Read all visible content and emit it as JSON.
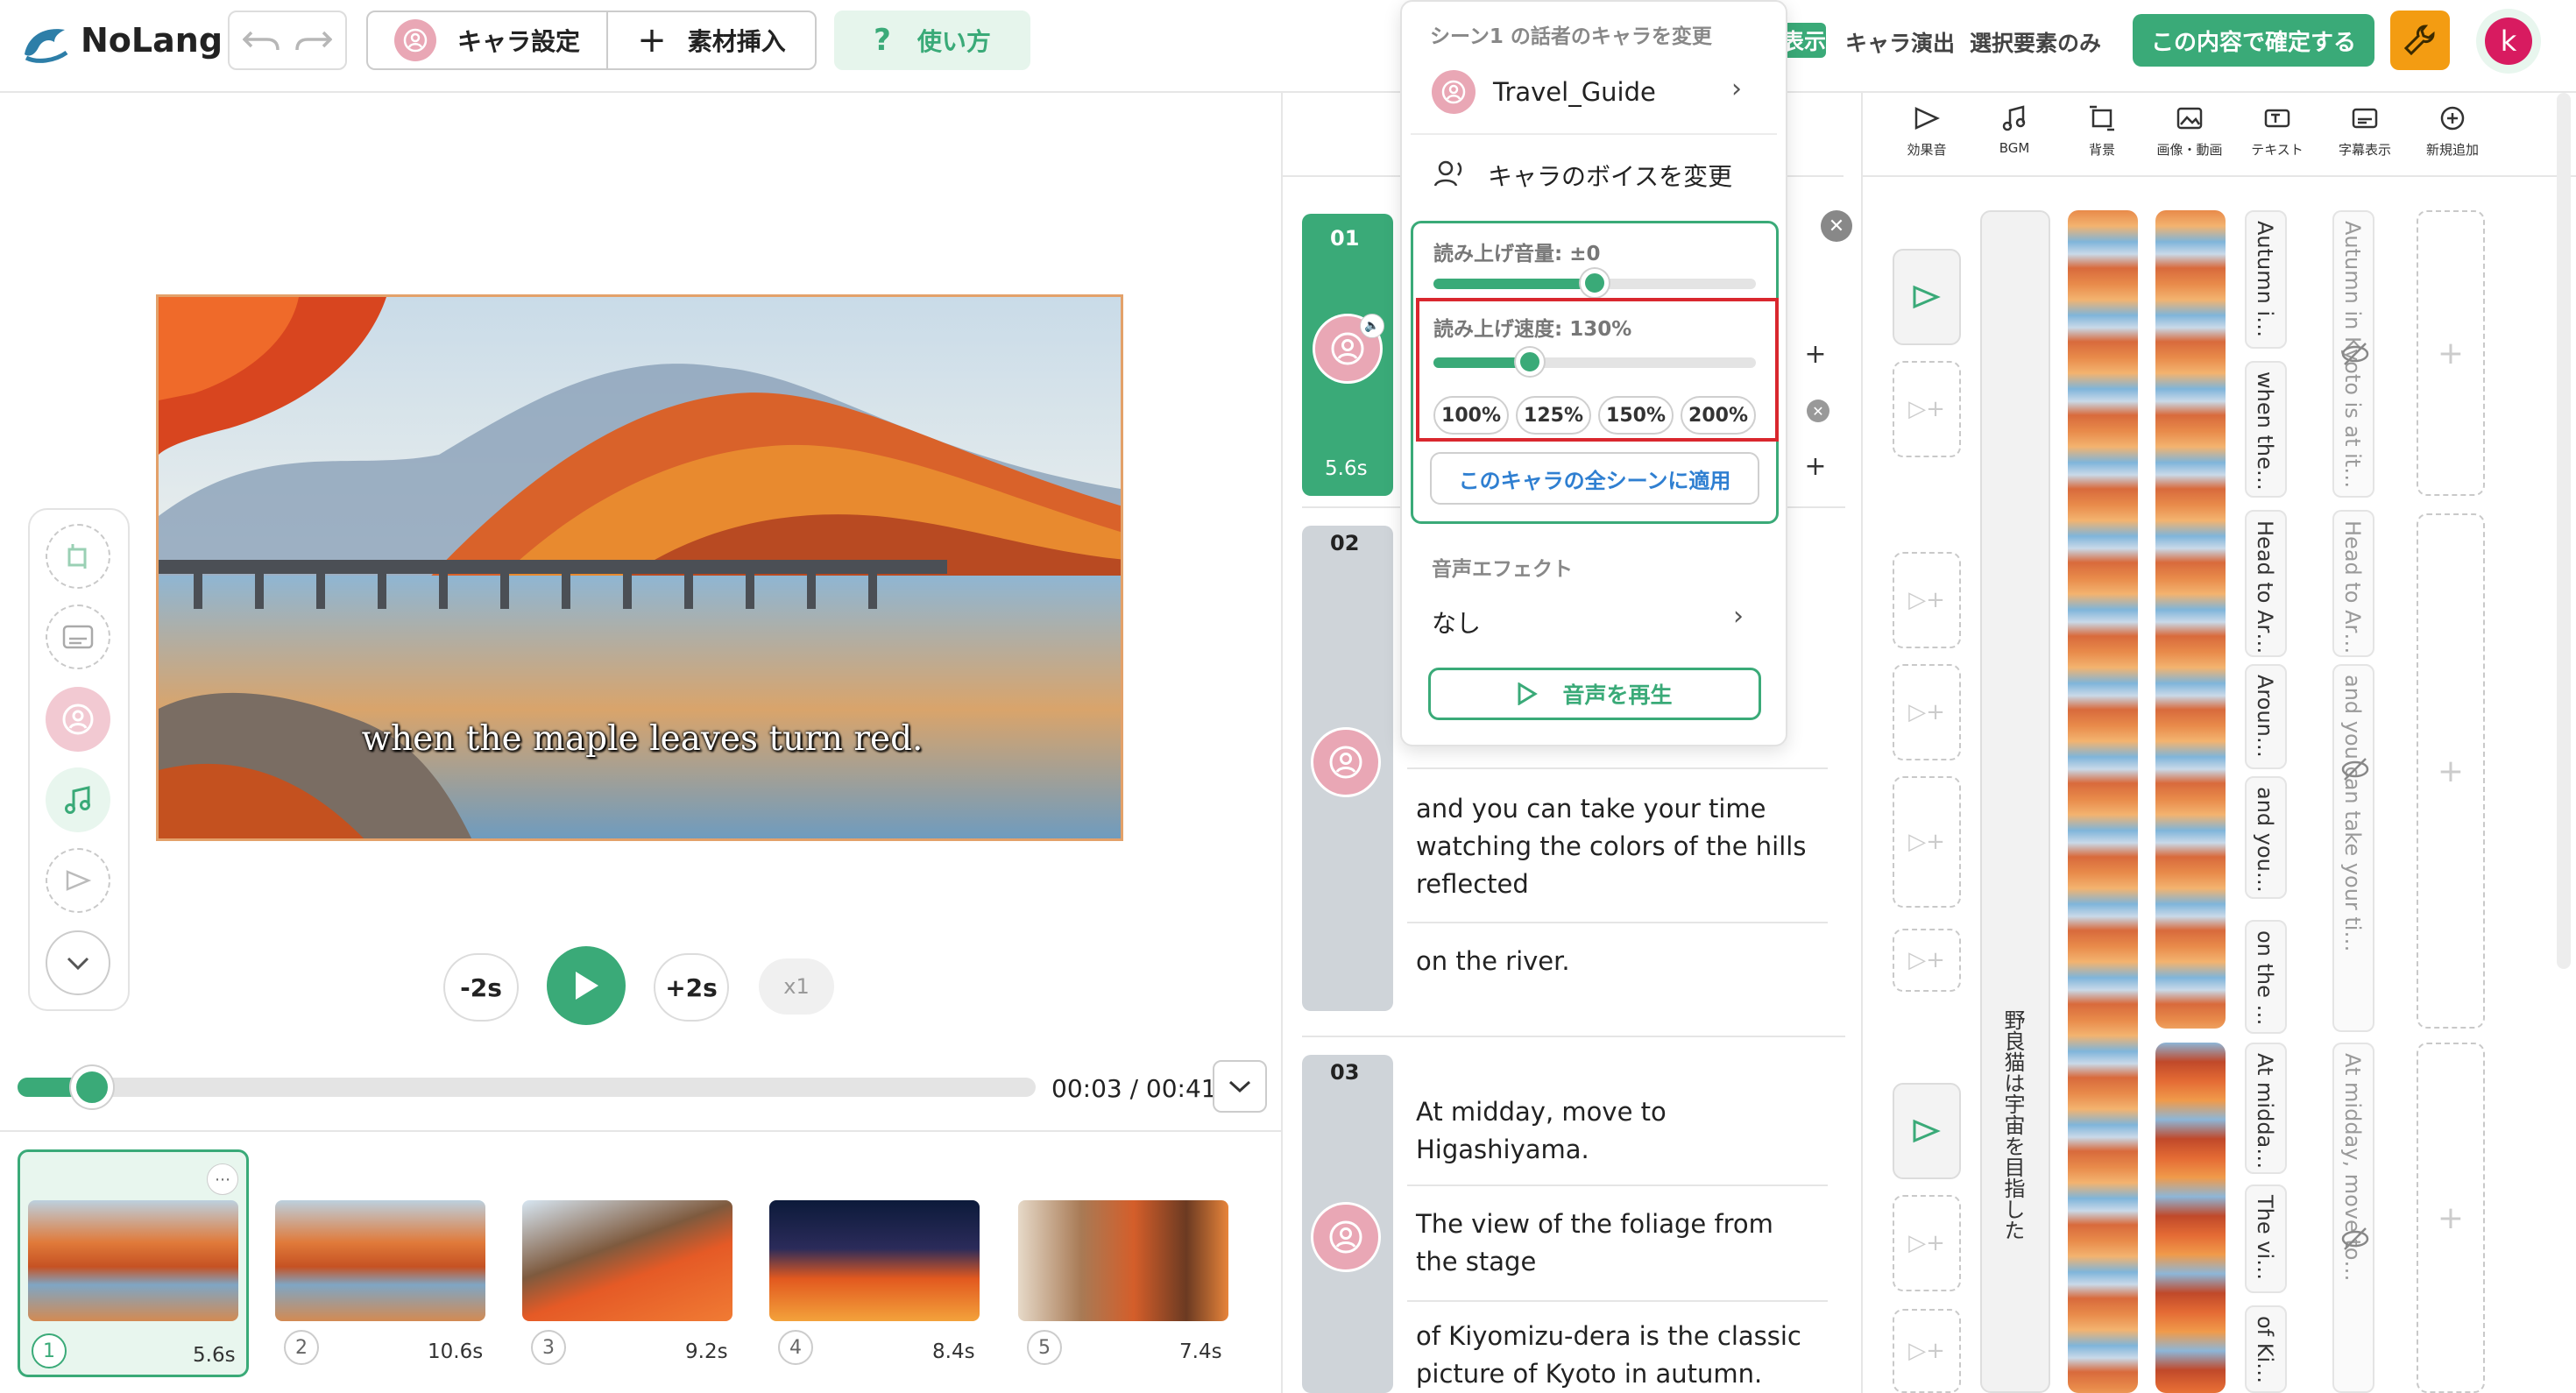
{
  "app": {
    "name": "NoLang"
  },
  "toolbar": {
    "char_settings": "キャラ設定",
    "insert_material": "素材挿入",
    "how_to_use": "使い方",
    "display_mode": "表示",
    "char_effects": "キャラ演出",
    "selected_only": "選択要素のみ",
    "confirm": "この内容で確定する",
    "avatar_letter": "k"
  },
  "preview": {
    "subtitle": "when the maple leaves turn red.",
    "back_label": "-2s",
    "forward_label": "+2s",
    "speed": "x1",
    "time": "00:03 / 00:41",
    "progress": 0.073
  },
  "scenes_strip": [
    {
      "num": "1",
      "dur": "5.6s"
    },
    {
      "num": "2",
      "dur": "10.6s"
    },
    {
      "num": "3",
      "dur": "9.2s"
    },
    {
      "num": "4",
      "dur": "8.4s"
    },
    {
      "num": "5",
      "dur": "7.4s"
    }
  ],
  "script": {
    "scene1": {
      "num": "01",
      "dur": "5.6s"
    },
    "scene2": {
      "num": "02",
      "lines": [
        "and you can take your time watching the colors of the hills reflected",
        "on the river."
      ]
    },
    "scene3": {
      "num": "03",
      "lines": [
        "At midday, move to Higashiyama.",
        "The view of the foliage from the stage",
        "of Kiyomizu-dera is the classic picture of Kyoto in autumn."
      ]
    }
  },
  "popup": {
    "header": "シーン1 の話者のキャラを変更",
    "character": "Travel_Guide",
    "change_voice": "キャラのボイスを変更",
    "volume_label": "読み上げ音量: ±0",
    "volume_level": 0.5,
    "speed_label": "読み上げ速度: 130%",
    "speed_level": 0.3,
    "speed_options": [
      "100%",
      "125%",
      "150%",
      "200%"
    ],
    "apply_all": "このキャラの全シーンに適用",
    "effect_label": "音声エフェクト",
    "effect_value": "なし",
    "play_voice": "音声を再生"
  },
  "timeline": {
    "tools": [
      {
        "icon": "sound-effect-icon",
        "label": "効果音"
      },
      {
        "icon": "bgm-icon",
        "label": "BGM"
      },
      {
        "icon": "background-icon",
        "label": "背景"
      },
      {
        "icon": "image-video-icon",
        "label": "画像・動画"
      },
      {
        "icon": "text-icon",
        "label": "テキスト"
      },
      {
        "icon": "subtitle-icon",
        "label": "字幕表示"
      },
      {
        "icon": "add-new-icon",
        "label": "新規追加"
      }
    ],
    "bgm_track": "野良猫は宇宙を目指した",
    "subs": [
      "Autumn in Kyoto is at i…",
      "when the maple leav…",
      "Head to Arashiyama…",
      "Around Togetsu…",
      "and you can take your…",
      "on the river.",
      "At midday, move to…",
      "The view of the…",
      "of Kiyomizu-dera is th…"
    ],
    "texts": [
      "Autumn in Kyoto is at it…",
      "when the maple leave…",
      "Head to Arashiyama…",
      "Around Togetsuk…",
      "and you can take your ti…",
      "on the river.",
      "At midday, move to…",
      "The view of the…",
      "of Kiyomizu-dera is the…"
    ]
  },
  "colors": {
    "accent": "#3aaa78",
    "highlight": "#d9272e",
    "brand_orange": "#f39c12"
  }
}
